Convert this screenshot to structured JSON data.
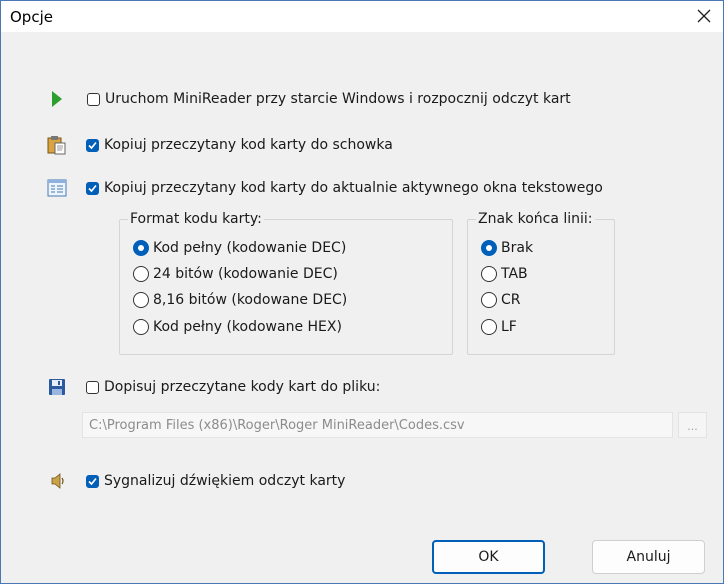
{
  "window": {
    "title": "Opcje"
  },
  "options": {
    "autostart": {
      "label": "Uruchom MiniReader przy starcie Windows i rozpocznij odczyt kart",
      "checked": false
    },
    "clipboard": {
      "label": "Kopiuj przeczytany kod karty do schowka",
      "checked": true
    },
    "active_window": {
      "label": "Kopiuj przeczytany kod karty do aktualnie aktywnego okna tekstowego",
      "checked": true
    },
    "append_file": {
      "label": "Dopisuj przeczytane kody kart do pliku:",
      "checked": false
    },
    "sound": {
      "label": "Sygnalizuj dźwiękiem odczyt karty",
      "checked": true
    }
  },
  "format_group": {
    "title": "Format kodu karty:",
    "options": [
      {
        "label": "Kod pełny (kodowanie DEC)",
        "selected": true
      },
      {
        "label": "24 bitów (kodowanie DEC)",
        "selected": false
      },
      {
        "label": "8,16 bitów (kodowane DEC)",
        "selected": false
      },
      {
        "label": "Kod pełny (kodowane HEX)",
        "selected": false
      }
    ]
  },
  "eol_group": {
    "title": "Znak końca linii:",
    "options": [
      {
        "label": "Brak",
        "selected": true
      },
      {
        "label": "TAB",
        "selected": false
      },
      {
        "label": "CR",
        "selected": false
      },
      {
        "label": "LF",
        "selected": false
      }
    ]
  },
  "file": {
    "path": "C:\\Program Files (x86)\\Roger\\Roger MiniReader\\Codes.csv",
    "browse_label": "..."
  },
  "buttons": {
    "ok": "OK",
    "cancel": "Anuluj"
  },
  "colors": {
    "accent": "#005fb8",
    "play_icon": "#2e9e2e",
    "window_border": "#4a78b5"
  },
  "icons": [
    "play-icon",
    "clipboard-icon",
    "window-text-icon",
    "floppy-disk-icon",
    "speaker-icon",
    "close-icon",
    "checkmark-icon"
  ]
}
